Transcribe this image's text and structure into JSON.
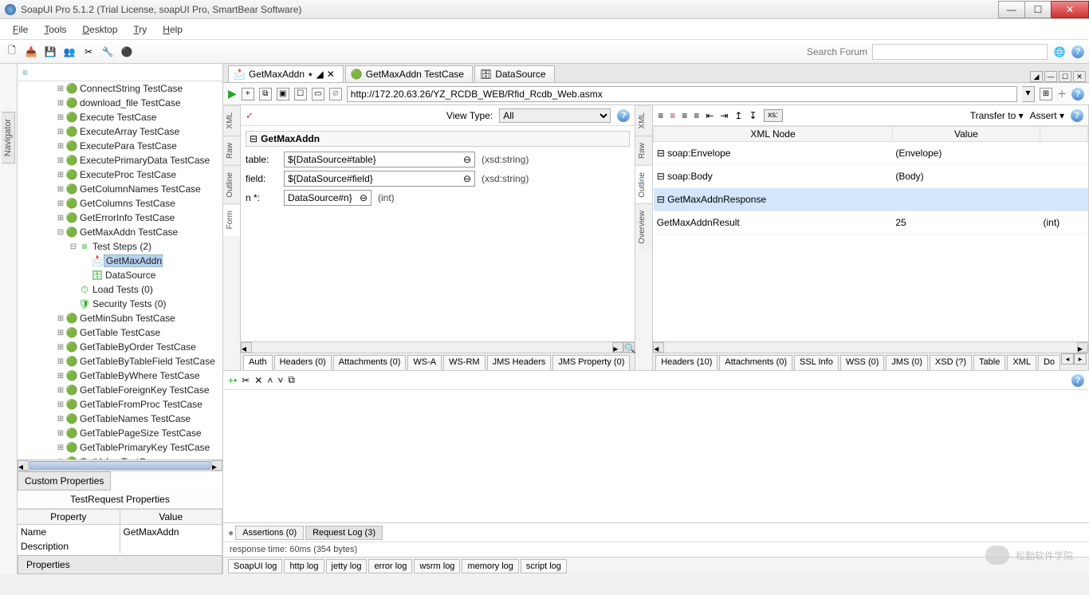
{
  "title": "SoapUI Pro 5.1.2 (Trial License, soapUI Pro, SmartBear Software)",
  "menu": [
    "File",
    "Tools",
    "Desktop",
    "Try",
    "Help"
  ],
  "search_label": "Search Forum",
  "nav_tab": "Navigator",
  "tree": [
    {
      "d": 3,
      "e": "⊞",
      "i": "🟢",
      "l": "ConnectString TestCase"
    },
    {
      "d": 3,
      "e": "⊞",
      "i": "🟢",
      "l": "download_file TestCase"
    },
    {
      "d": 3,
      "e": "⊞",
      "i": "🟢",
      "l": "Execute TestCase"
    },
    {
      "d": 3,
      "e": "⊞",
      "i": "🟢",
      "l": "ExecuteArray TestCase"
    },
    {
      "d": 3,
      "e": "⊞",
      "i": "🟢",
      "l": "ExecutePara TestCase"
    },
    {
      "d": 3,
      "e": "⊞",
      "i": "🟢",
      "l": "ExecutePrimaryData TestCase"
    },
    {
      "d": 3,
      "e": "⊞",
      "i": "🟢",
      "l": "ExecuteProc TestCase"
    },
    {
      "d": 3,
      "e": "⊞",
      "i": "🟢",
      "l": "GetColumnNames TestCase"
    },
    {
      "d": 3,
      "e": "⊞",
      "i": "🟢",
      "l": "GetColumns TestCase"
    },
    {
      "d": 3,
      "e": "⊞",
      "i": "🟢",
      "l": "GetErrorInfo TestCase"
    },
    {
      "d": 3,
      "e": "⊟",
      "i": "🟢",
      "l": "GetMaxAddn TestCase"
    },
    {
      "d": 4,
      "e": "⊟",
      "i": "≡",
      "l": "Test Steps (2)"
    },
    {
      "d": 5,
      "e": "",
      "i": "📩",
      "l": "GetMaxAddn",
      "sel": true
    },
    {
      "d": 5,
      "e": "",
      "i": "🗄",
      "l": "DataSource"
    },
    {
      "d": 4,
      "e": "",
      "i": "⏱",
      "l": "Load Tests (0)"
    },
    {
      "d": 4,
      "e": "",
      "i": "🛡",
      "l": "Security Tests (0)"
    },
    {
      "d": 3,
      "e": "⊞",
      "i": "🟢",
      "l": "GetMinSubn TestCase"
    },
    {
      "d": 3,
      "e": "⊞",
      "i": "🟢",
      "l": "GetTable TestCase"
    },
    {
      "d": 3,
      "e": "⊞",
      "i": "🟢",
      "l": "GetTableByOrder TestCase"
    },
    {
      "d": 3,
      "e": "⊞",
      "i": "🟢",
      "l": "GetTableByTableField TestCase"
    },
    {
      "d": 3,
      "e": "⊞",
      "i": "🟢",
      "l": "GetTableByWhere TestCase"
    },
    {
      "d": 3,
      "e": "⊞",
      "i": "🟢",
      "l": "GetTableForeignKey TestCase"
    },
    {
      "d": 3,
      "e": "⊞",
      "i": "🟢",
      "l": "GetTableFromProc TestCase"
    },
    {
      "d": 3,
      "e": "⊞",
      "i": "🟢",
      "l": "GetTableNames TestCase"
    },
    {
      "d": 3,
      "e": "⊞",
      "i": "🟢",
      "l": "GetTablePageSize TestCase"
    },
    {
      "d": 3,
      "e": "⊞",
      "i": "🟢",
      "l": "GetTablePrimaryKey TestCase"
    },
    {
      "d": 3,
      "e": "⊞",
      "i": "🟢",
      "l": "GetValue TestCase"
    }
  ],
  "custom_props_tab": "Custom Properties",
  "props_header": "TestRequest Properties",
  "prop_col": "Property",
  "val_col": "Value",
  "name_prop": "Name",
  "name_val": "GetMaxAddn",
  "desc_prop": "Description",
  "properties_tab": "Properties",
  "doctabs": [
    {
      "i": "📩",
      "l": "GetMaxAddn",
      "mod": "٭",
      "active": true,
      "close": true
    },
    {
      "i": "🟢",
      "l": "GetMaxAddn TestCase"
    },
    {
      "i": "🗄",
      "l": "DataSource"
    }
  ],
  "url": "http://172.20.63.26/YZ_RCDB_WEB/Rfid_Rcdb_Web.asmx",
  "vtabs_left": [
    "XML",
    "Raw",
    "Outline",
    "Form"
  ],
  "vtabs_right": [
    "XML",
    "Raw",
    "Outline",
    "Overview"
  ],
  "viewtype_label": "View Type:",
  "viewtype_value": "All",
  "form_title": "GetMaxAddn",
  "form_rows": [
    {
      "label": "table:",
      "value": "${DataSource#table}",
      "type": "(xsd:string)"
    },
    {
      "label": "field:",
      "value": "${DataSource#field}",
      "type": "(xsd:string)"
    },
    {
      "label": "n *:",
      "value": "DataSource#n}",
      "type": "(int)",
      "narrow": true
    }
  ],
  "resp_toolbar": {
    "transfer": "Transfer to ▾",
    "assert": "Assert ▾",
    "xs": "xs:"
  },
  "resp_header": {
    "node": "XML Node",
    "value": "Value"
  },
  "resp_rows": [
    {
      "ind": 0,
      "exp": "⊟",
      "l": "soap:Envelope",
      "v": "(Envelope)"
    },
    {
      "ind": 1,
      "exp": "⊟",
      "l": "soap:Body",
      "v": "(Body)"
    },
    {
      "ind": 2,
      "exp": "⊟",
      "l": "GetMaxAddnResponse",
      "v": "",
      "hl": true
    },
    {
      "ind": 3,
      "exp": "",
      "l": "GetMaxAddnResult",
      "v": "25",
      "v2": "(int)"
    }
  ],
  "left_tabs": [
    "Auth",
    "Headers (0)",
    "Attachments (0)",
    "WS-A",
    "WS-RM",
    "JMS Headers",
    "JMS Property (0)"
  ],
  "right_tabs": [
    "Headers (10)",
    "Attachments (0)",
    "SSL Info",
    "WSS (0)",
    "JMS (0)",
    "XSD (?)",
    "Table",
    "XML",
    "Do"
  ],
  "assert_tab": "Assertions (0)",
  "reqlog_tab": "Request Log (3)",
  "resp_status": "response time: 60ms (354 bytes)",
  "logs": [
    "SoapUI log",
    "http log",
    "jetty log",
    "error log",
    "wsrm log",
    "memory log",
    "script log"
  ],
  "watermark": "松勤软件学院"
}
